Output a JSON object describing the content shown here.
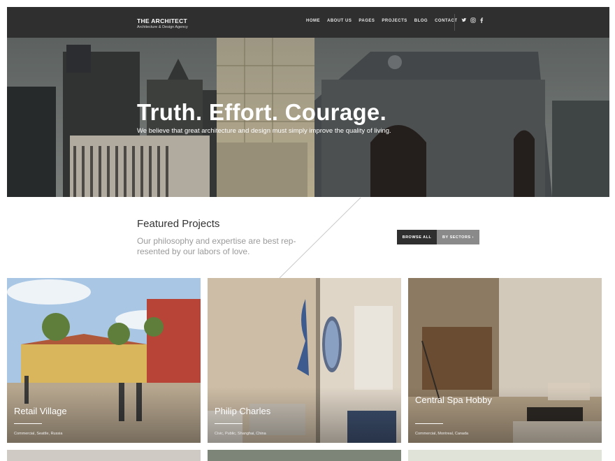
{
  "brand": {
    "name": "THE ARCHITECT",
    "tagline": "Architecture & Design Agency"
  },
  "nav": {
    "items": [
      "HOME",
      "ABOUT US",
      "PAGES",
      "PROJECTS",
      "BLOG",
      "CONTACT"
    ],
    "social_icons": [
      "twitter-icon",
      "instagram-icon",
      "facebook-icon"
    ]
  },
  "hero": {
    "title": "Truth. Effort. Courage.",
    "subtitle": "We believe that great architecture and design must simply improve the quality of living."
  },
  "featured": {
    "title": "Featured Projects",
    "text": "Our philosophy and expertise are best rep-resented by our labors of love.",
    "browse_all_label": "BROWSE ALL",
    "by_sectors_label": "BY SECTORS ›"
  },
  "projects": [
    {
      "title": "Retail Village",
      "location": "Commercial, Seattle, Russia"
    },
    {
      "title": "Philip Charles",
      "location": "Civic, Public, Shanghai, China"
    },
    {
      "title": "Central Spa Hobby",
      "location": "Commercial, Montreal, Canada"
    }
  ],
  "colors": {
    "navbar": "#2f2f2f",
    "button_dark": "#2f2f2f",
    "button_grey": "#8a8a8a",
    "text_muted": "#9a9a9a"
  }
}
